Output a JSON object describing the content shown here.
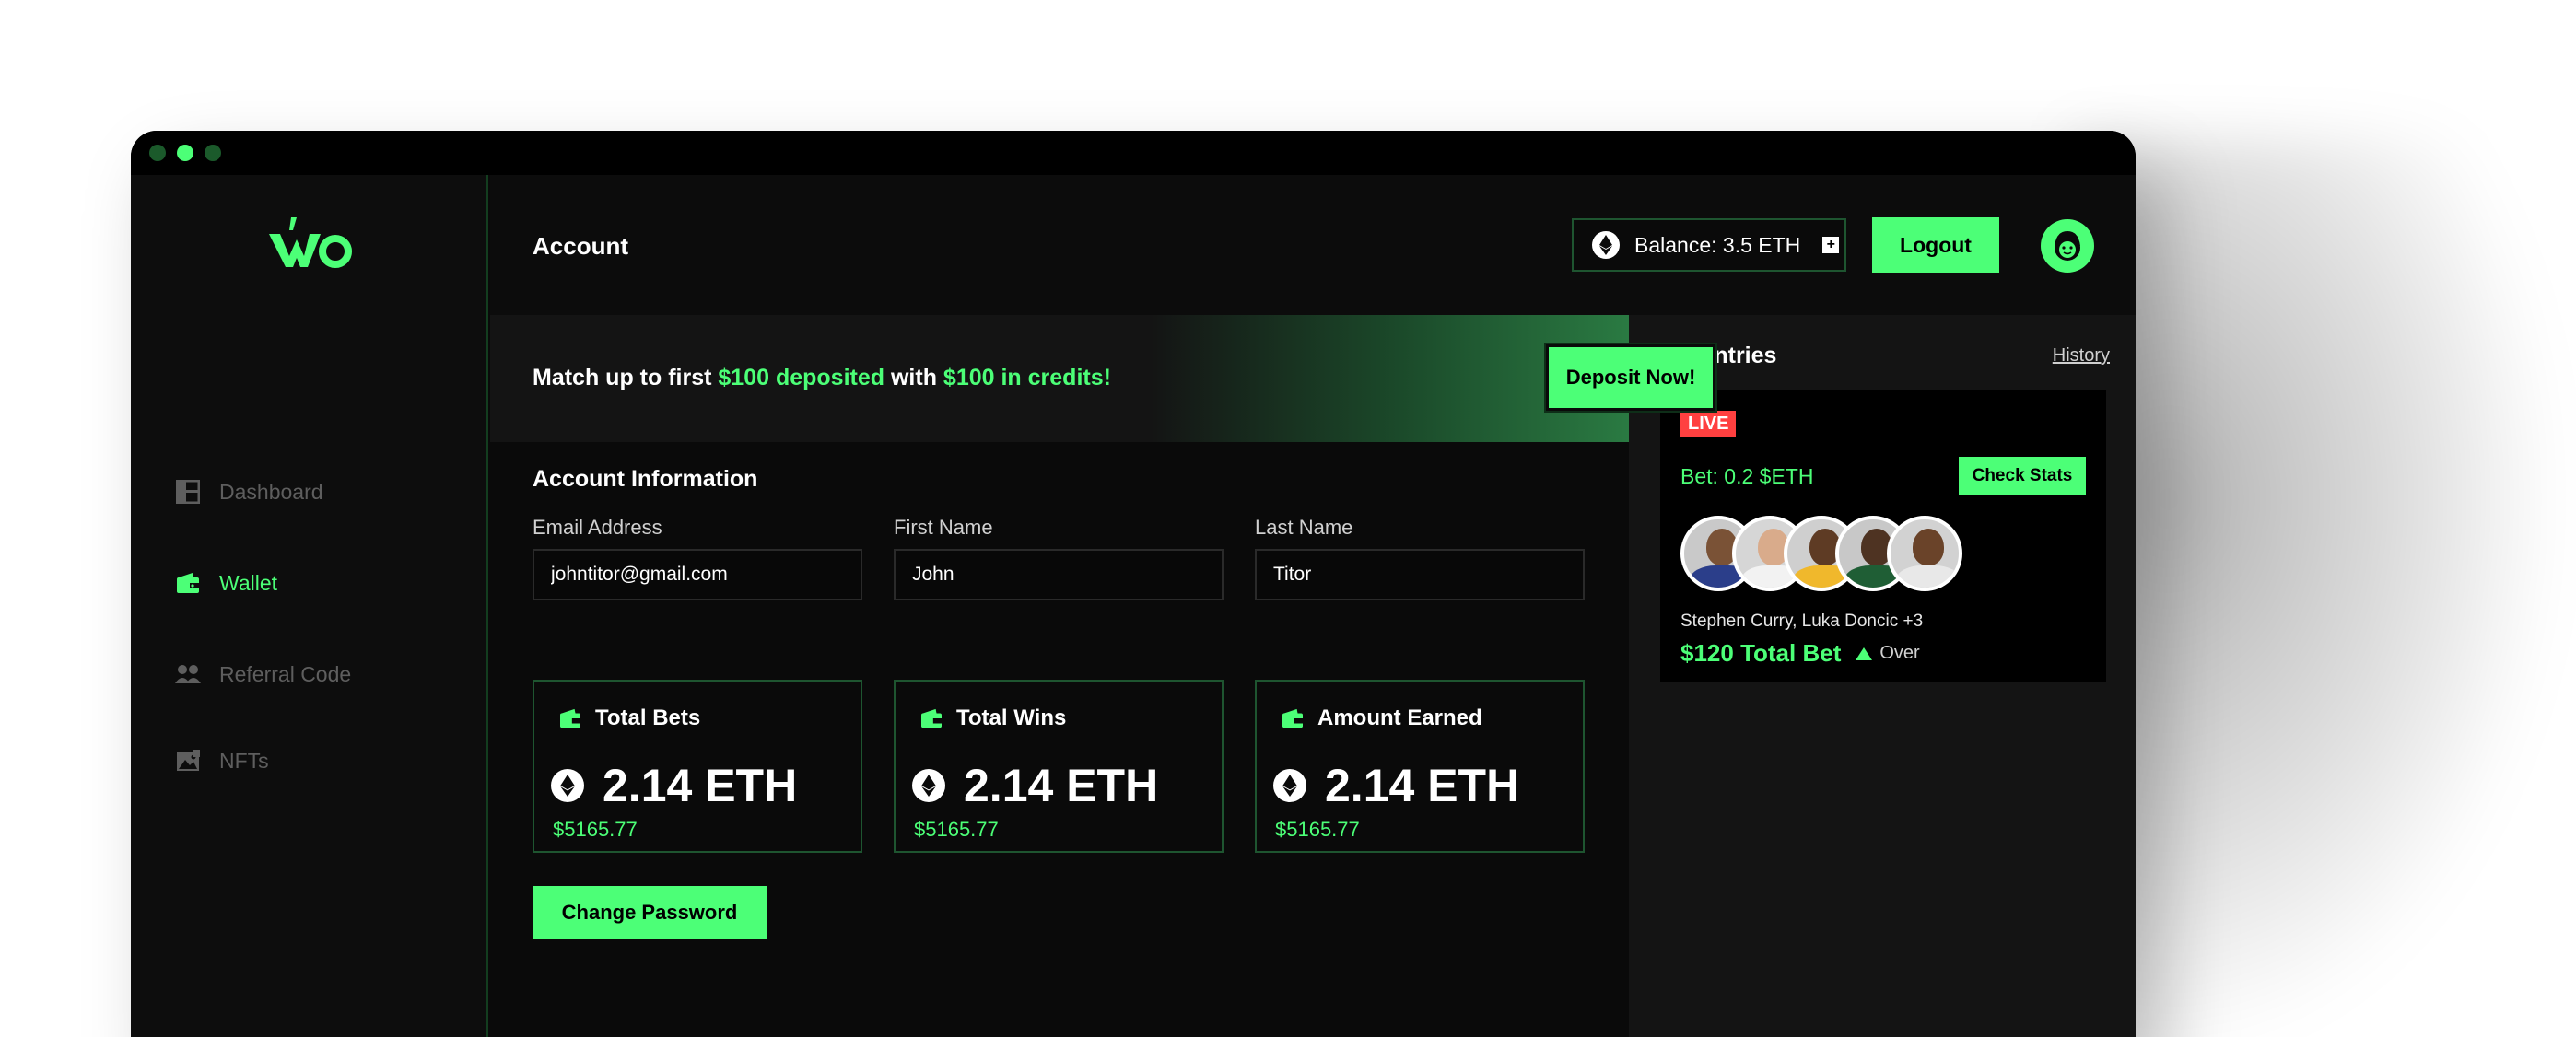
{
  "window": {
    "traffic_lights": [
      "dot-1",
      "dot-2",
      "dot-3"
    ]
  },
  "brand": {
    "logo_icon": "wo-logo-icon",
    "accent": "#4cff77",
    "background": "#0a0a0a",
    "live_color": "#ff4040"
  },
  "sidebar": {
    "items": [
      {
        "label": "Dashboard",
        "icon": "dashboard-icon",
        "active": false
      },
      {
        "label": "Wallet",
        "icon": "wallet-icon",
        "active": true
      },
      {
        "label": "Referral Code",
        "icon": "people-icon",
        "active": false
      },
      {
        "label": "NFTs",
        "icon": "image-icon",
        "active": false
      }
    ]
  },
  "header": {
    "title": "Account",
    "balance_label": "Balance: 3.5 ETH",
    "balance_icon": "ethereum-icon",
    "add_icon": "plus-icon",
    "logout_label": "Logout",
    "avatar_icon": "user-face-icon"
  },
  "promo": {
    "prefix": "Match up to first ",
    "highlight_1": "$100 deposited",
    "middle": " with ",
    "highlight_2": "$100 in credits!",
    "button_label": "Deposit Now!"
  },
  "account": {
    "section_title": "Account Information",
    "fields": [
      {
        "label": "Email Address",
        "value": "johntitor@gmail.com"
      },
      {
        "label": "First Name",
        "value": "John"
      },
      {
        "label": "Last Name",
        "value": "Titor"
      }
    ],
    "stats": [
      {
        "title": "Total Bets",
        "value": "2.14 ETH",
        "usd": "$5165.77"
      },
      {
        "title": "Total Wins",
        "value": "2.14 ETH",
        "usd": "$5165.77"
      },
      {
        "title": "Amount Earned",
        "value": "2.14 ETH",
        "usd": "$5165.77"
      }
    ],
    "change_password_label": "Change Password"
  },
  "entries": {
    "title": "My Entries",
    "history_label": "History",
    "card": {
      "badge": "LIVE",
      "bet": "Bet: 0.2 $ETH",
      "check_stats_label": "Check Stats",
      "players": [
        "player-1",
        "player-2",
        "player-3",
        "player-4",
        "player-5"
      ],
      "names": "Stephen Curry, Luka Doncic +3",
      "total_bet": "$120 Total Bet",
      "direction": "Over"
    }
  }
}
